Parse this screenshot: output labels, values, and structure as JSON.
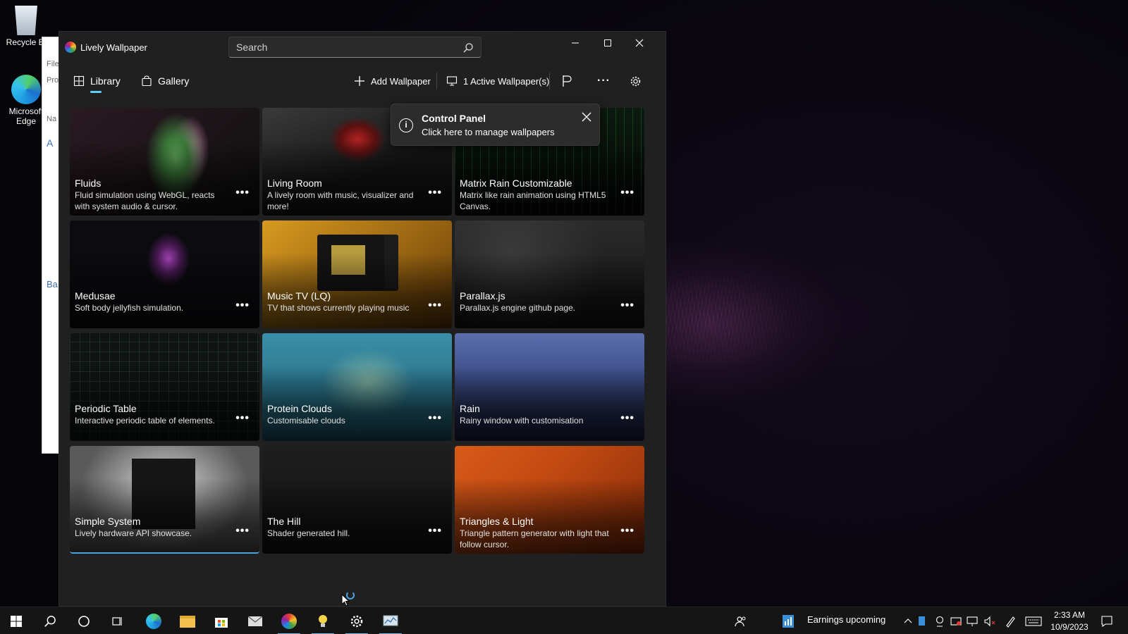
{
  "desktop": {
    "icons": [
      {
        "label": "Recycle Bi",
        "icon": "recycle-bin-icon"
      },
      {
        "label": "Microsoft Edge",
        "icon": "edge-icon"
      }
    ]
  },
  "explorer_fragment": {
    "items": [
      "File",
      "Pro",
      "Na",
      "A",
      "Ba"
    ]
  },
  "app": {
    "title": "Lively Wallpaper",
    "search_placeholder": "Search",
    "nav": {
      "library": "Library",
      "gallery": "Gallery",
      "add_wallpaper": "Add Wallpaper",
      "active_wallpapers": "1 Active Wallpaper(s)",
      "more": "···"
    },
    "tooltip": {
      "title": "Control Panel",
      "subtitle": "Click here to manage wallpapers"
    },
    "wallpapers": [
      {
        "title": "Fluids",
        "desc": "Fluid simulation using WebGL, reacts with system audio & cursor."
      },
      {
        "title": "Living Room",
        "desc": "A lively room with music, visualizer and more!"
      },
      {
        "title": "Matrix Rain Customizable",
        "desc": "Matrix like rain animation using HTML5 Canvas."
      },
      {
        "title": "Medusae",
        "desc": "Soft body jellyfish simulation."
      },
      {
        "title": "Music TV (LQ)",
        "desc": "TV that shows currently playing music"
      },
      {
        "title": "Parallax.js",
        "desc": "Parallax.js engine github page."
      },
      {
        "title": "Periodic Table",
        "desc": "Interactive periodic table of elements."
      },
      {
        "title": "Protein Clouds",
        "desc": "Customisable clouds"
      },
      {
        "title": "Rain",
        "desc": "Rainy window with customisation"
      },
      {
        "title": "Simple System",
        "desc": "Lively hardware API showcase."
      },
      {
        "title": "The Hill",
        "desc": "Shader generated hill."
      },
      {
        "title": "Triangles & Light",
        "desc": "Triangle pattern generator with light that follow cursor."
      }
    ],
    "more_label": "•••"
  },
  "taskbar": {
    "news": "Earnings upcoming",
    "time": "2:33 AM",
    "date": "10/9/2023"
  },
  "colors": {
    "accent": "#60cdff",
    "window_bg": "#202020",
    "taskbar_bg": "#151515"
  }
}
